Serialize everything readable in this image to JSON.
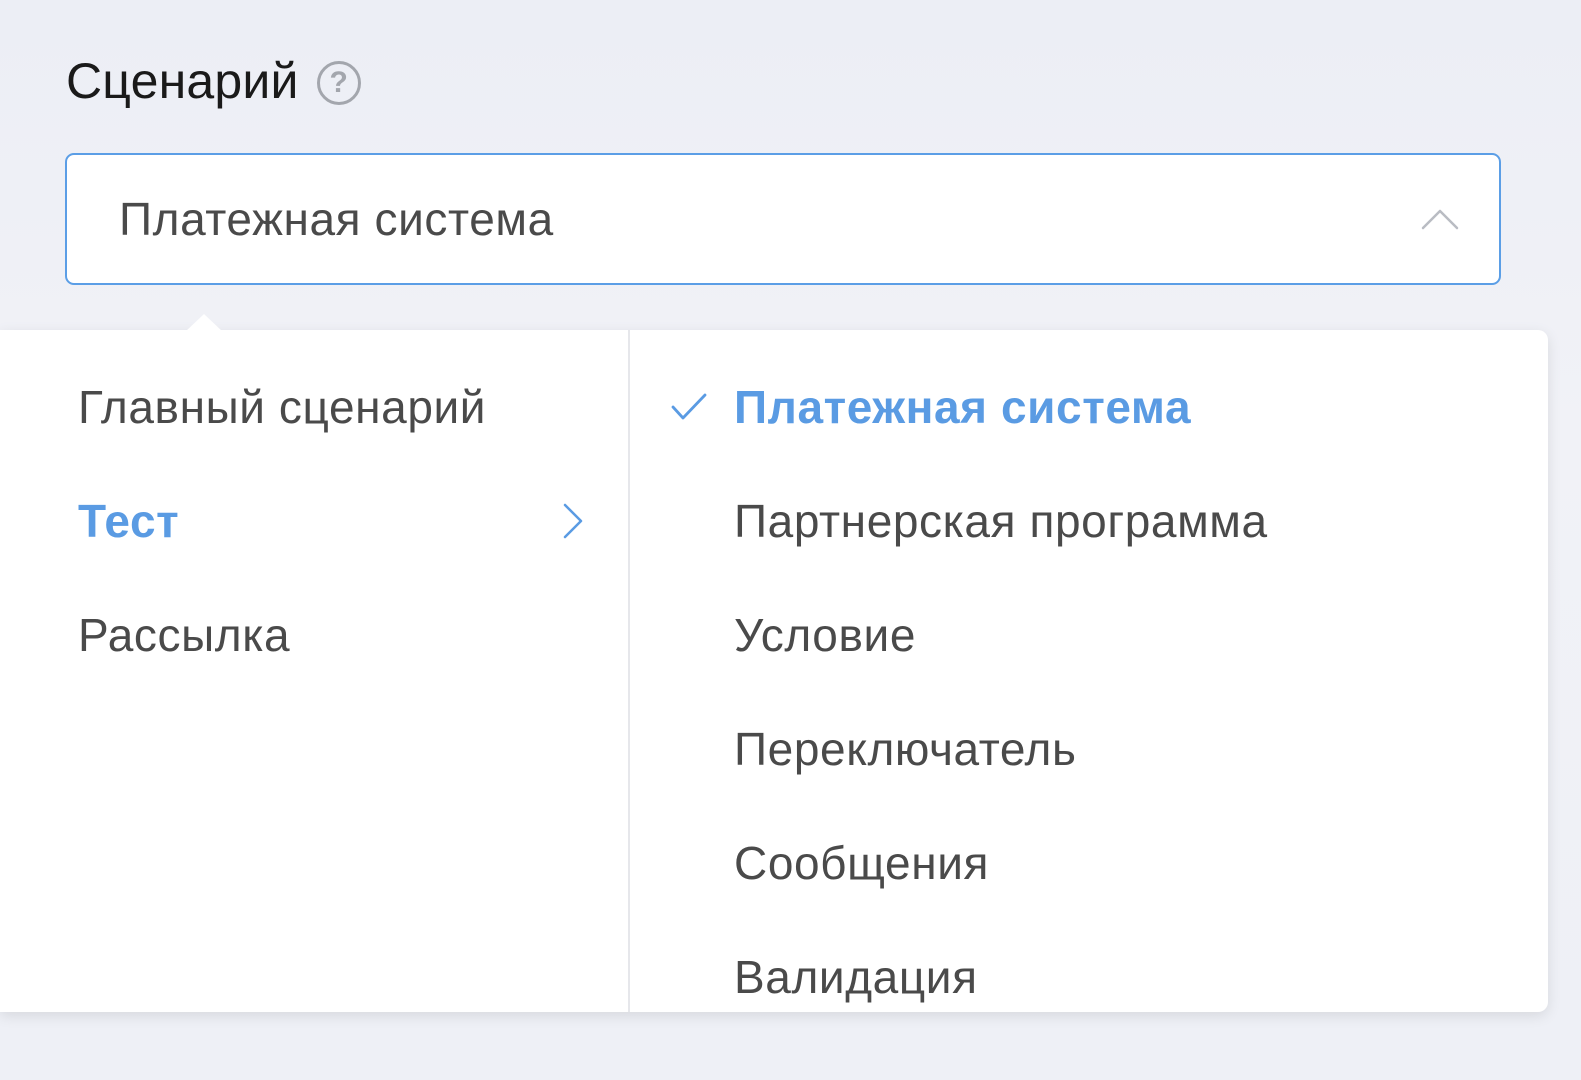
{
  "field": {
    "label": "Сценарий",
    "help_icon": "question-circle-icon"
  },
  "select": {
    "value": "Платежная система",
    "icon": "chevron-up-icon"
  },
  "menu": {
    "categories": [
      {
        "label": "Главный сценарий",
        "active": false
      },
      {
        "label": "Тест",
        "active": true
      },
      {
        "label": "Рассылка",
        "active": false
      }
    ],
    "options": [
      {
        "label": "Платежная система",
        "selected": true
      },
      {
        "label": "Партнерская программа",
        "selected": false
      },
      {
        "label": "Условие",
        "selected": false
      },
      {
        "label": "Переключатель",
        "selected": false
      },
      {
        "label": "Сообщения",
        "selected": false
      },
      {
        "label": "Валидация",
        "selected": false
      }
    ]
  },
  "colors": {
    "accent": "#5a9be3",
    "text": "#4a4a4a",
    "border_focus": "#5b9ee6"
  }
}
